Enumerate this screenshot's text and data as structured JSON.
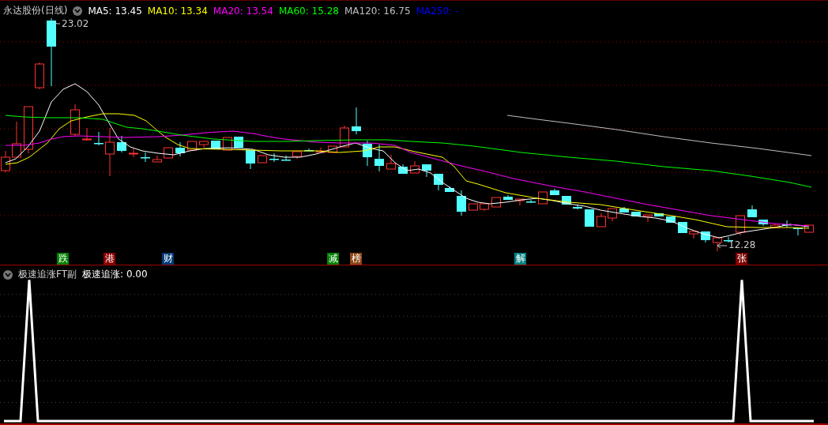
{
  "main_chart": {
    "title": "永达股份(日线)",
    "legend": [
      {
        "label": "MA5: 13.45",
        "color": "#ffffff"
      },
      {
        "label": "MA10: 13.34",
        "color": "#ffff00"
      },
      {
        "label": "MA20: 13.54",
        "color": "#ff00ff"
      },
      {
        "label": "MA60: 15.28",
        "color": "#00ff00"
      },
      {
        "label": "MA120: 16.75",
        "color": "#c0c0c0"
      },
      {
        "label": "MA250: -",
        "color": "#0000ff"
      }
    ],
    "high_label": "23.02",
    "low_label": "12.28",
    "event_tags": [
      {
        "text": "跌",
        "color": "#008000"
      },
      {
        "text": "港",
        "color": "#8b0000"
      },
      {
        "text": "财",
        "color": "#003a78"
      },
      {
        "text": "减",
        "color": "#008000"
      },
      {
        "text": "榜",
        "color": "#8b4513"
      },
      {
        "text": "解",
        "color": "#008080"
      },
      {
        "text": "张",
        "color": "#800000"
      }
    ]
  },
  "indicator_panel": {
    "title": "极速追涨FT副",
    "reading": "极速追涨: 0.00"
  }
}
